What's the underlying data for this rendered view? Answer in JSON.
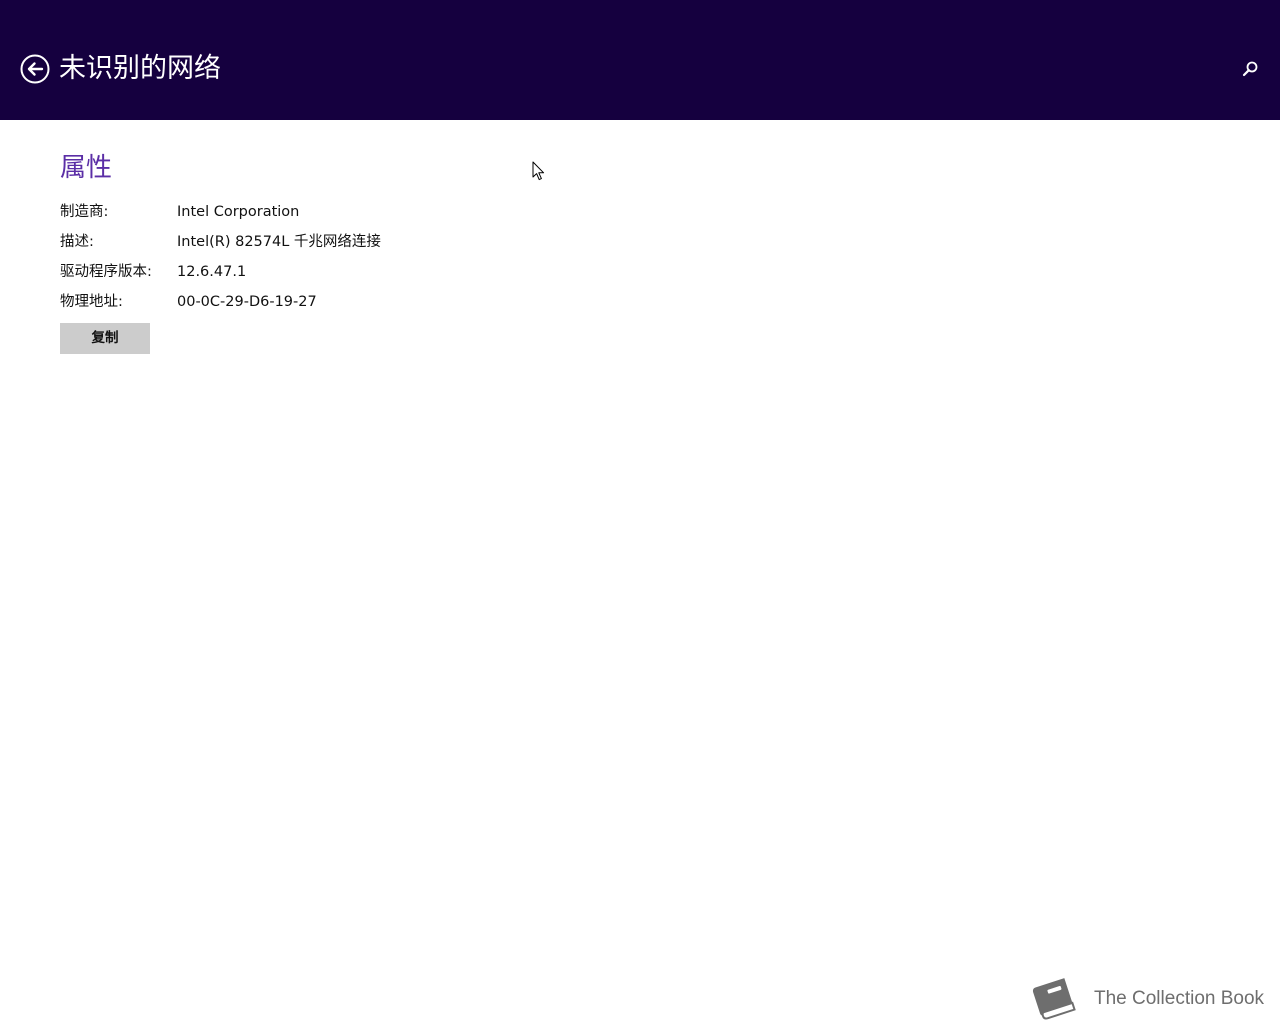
{
  "header": {
    "title": "未识别的网络",
    "back_icon": "back-arrow-circle-icon",
    "search_icon": "search-icon",
    "background_color": "#15003f"
  },
  "properties": {
    "section_title": "属性",
    "title_color": "#5b2ea6",
    "rows": [
      {
        "label": "制造商:",
        "value": "Intel Corporation"
      },
      {
        "label": "描述:",
        "value": "Intel(R) 82574L 千兆网络连接"
      },
      {
        "label": "驱动程序版本:",
        "value": "12.6.47.1"
      },
      {
        "label": "物理地址:",
        "value": "00-0C-29-D6-19-27"
      }
    ],
    "copy_button_label": "复制"
  },
  "watermark": {
    "text": "The Collection Book",
    "icon": "book-icon"
  }
}
